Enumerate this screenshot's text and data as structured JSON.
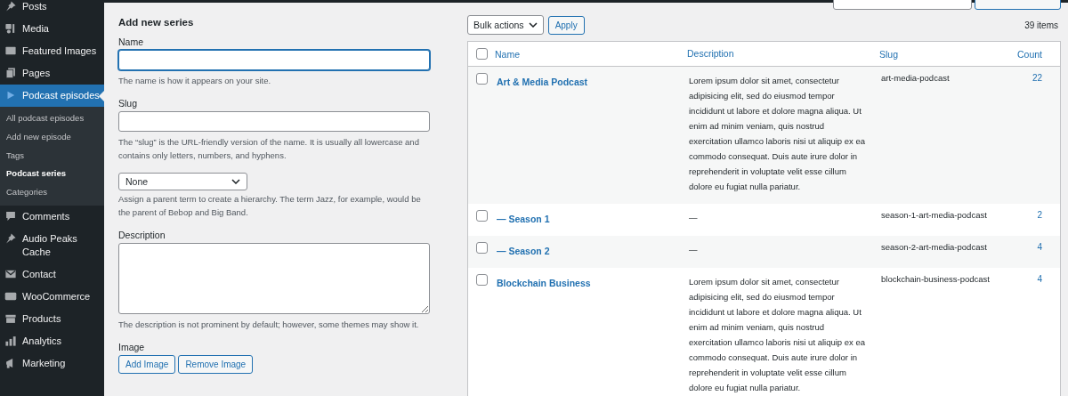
{
  "sidebar": {
    "items": [
      {
        "label": "Posts",
        "selected": false
      },
      {
        "label": "Media",
        "selected": false
      },
      {
        "label": "Featured Images",
        "selected": false
      },
      {
        "label": "Pages",
        "selected": false
      },
      {
        "label": "Podcast episodes",
        "selected": true,
        "children": [
          {
            "label": "All podcast episodes",
            "selected": false
          },
          {
            "label": "Add new episode",
            "selected": false
          },
          {
            "label": "Tags",
            "selected": false
          },
          {
            "label": "Podcast series",
            "selected": true
          },
          {
            "label": "Categories",
            "selected": false
          }
        ]
      },
      {
        "label": "Comments",
        "selected": false
      },
      {
        "label": "Audio Peaks Cache",
        "selected": false
      },
      {
        "label": "Contact",
        "selected": false
      },
      {
        "label": "WooCommerce",
        "selected": false
      },
      {
        "label": "Products",
        "selected": false
      },
      {
        "label": "Analytics",
        "selected": false
      },
      {
        "label": "Marketing",
        "selected": false
      }
    ]
  },
  "form": {
    "title": "Add new series",
    "name": {
      "label": "Name",
      "help": "The name is how it appears on your site."
    },
    "slug": {
      "label": "Slug",
      "help": "The “slug” is the URL-friendly version of the name. It is usually all lowercase and contains only letters, numbers, and hyphens."
    },
    "parent": {
      "value": "None",
      "help": "Assign a parent term to create a hierarchy. The term Jazz, for example, would be the parent of Bebop and Big Band."
    },
    "description": {
      "label": "Description",
      "help": "The description is not prominent by default; however, some themes may show it."
    },
    "image": {
      "label": "Image",
      "buttons": [
        "Add Image",
        "Remove Image"
      ]
    }
  },
  "table": {
    "bulk_actions": "Bulk actions",
    "apply": "Apply",
    "count": "39 items",
    "select_all": {
      "checked": false
    },
    "columns": [
      "Name",
      "Description",
      "Slug",
      "Count"
    ],
    "rows": [
      {
        "name": "Art & Media Podcast",
        "description": "Lorem ipsum dolor sit amet, consectetur adipisicing elit, sed do eiusmod tempor incididunt ut labore et dolore magna aliqua. Ut enim ad minim veniam, quis nostrud exercitation ullamco laboris nisi ut aliquip ex ea commodo consequat. Duis aute irure dolor in reprehenderit in voluptate velit esse cillum dolore eu fugiat nulla pariatur.",
        "slug": "art-media-podcast",
        "count": "22",
        "checked": false
      },
      {
        "name": "— Season 1",
        "description": "—",
        "slug": "season-1-art-media-podcast",
        "count": "2",
        "checked": false
      },
      {
        "name": "— Season 2",
        "description": "—",
        "slug": "season-2-art-media-podcast",
        "count": "4",
        "checked": false
      },
      {
        "name": "Blockchain Business",
        "description": "Lorem ipsum dolor sit amet, consectetur adipisicing elit, sed do eiusmod tempor incididunt ut labore et dolore magna aliqua. Ut enim ad minim veniam, quis nostrud exercitation ullamco laboris nisi ut aliquip ex ea commodo consequat. Duis aute irure dolor in reprehenderit in voluptate velit esse cillum dolore eu fugiat nulla pariatur.",
        "slug": "blockchain-business-podcast",
        "count": "4",
        "checked": false
      }
    ]
  }
}
